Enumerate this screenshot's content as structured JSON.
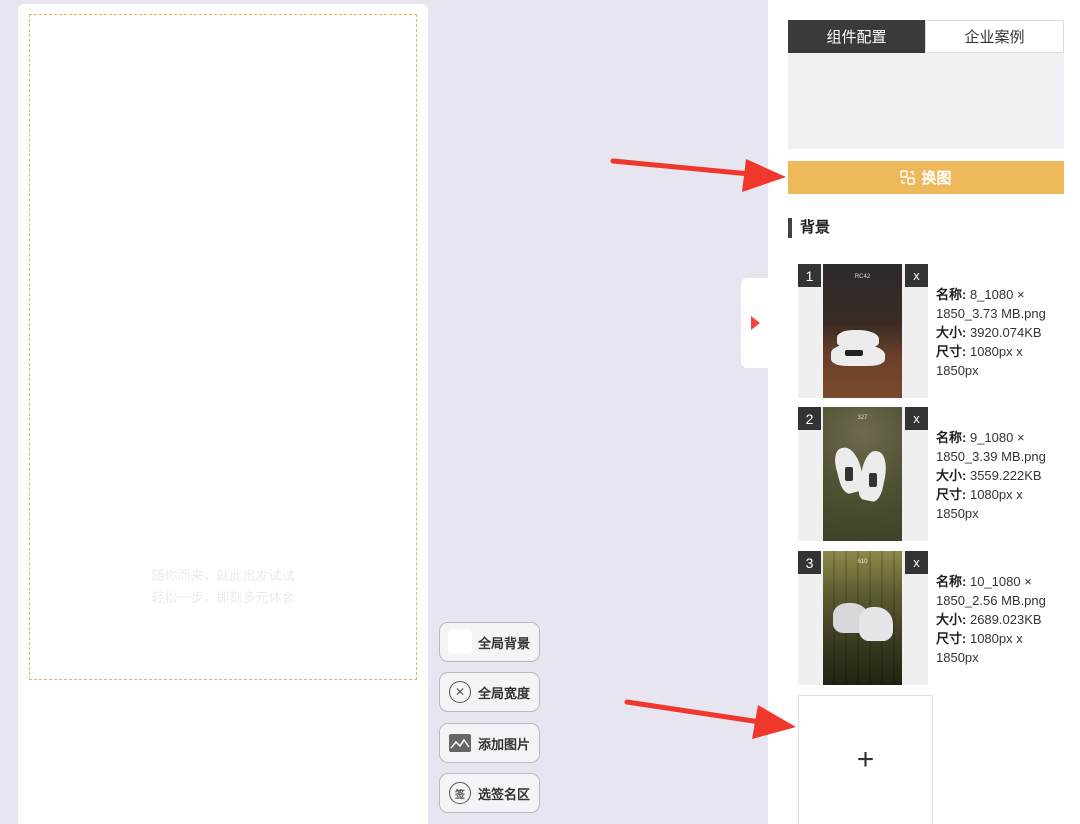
{
  "canvas": {
    "placeholder_line1": "随你而来，就此出发试试",
    "placeholder_line2": "轻松一步，即刻多元体会"
  },
  "tools": [
    {
      "label": "全局背景",
      "icon": "swatch-icon"
    },
    {
      "label": "全局宽度",
      "icon": "close-circle-icon"
    },
    {
      "label": "添加图片",
      "icon": "image-icon"
    },
    {
      "label": "选签名区",
      "icon": "sign-icon"
    }
  ],
  "tool_sign_glyph": "签",
  "panel": {
    "tabs": [
      "组件配置",
      "企业案例"
    ],
    "swap_label": "换图",
    "section_title": "背景",
    "items": [
      {
        "num": "1",
        "delete": "x",
        "badge": "RC42",
        "name_label": "名称:",
        "name": "8_1080 × 1850_3.73 MB.png",
        "size_label": "大小:",
        "size": "3920.074KB",
        "dim_label": "尺寸:",
        "dim": "1080px x 1850px"
      },
      {
        "num": "2",
        "delete": "x",
        "badge": "327",
        "name_label": "名称:",
        "name": "9_1080 × 1850_3.39 MB.png",
        "size_label": "大小:",
        "size": "3559.222KB",
        "dim_label": "尺寸:",
        "dim": "1080px x 1850px"
      },
      {
        "num": "3",
        "delete": "x",
        "badge": "610",
        "name_label": "名称:",
        "name": "10_1080 × 1850_2.56 MB.png",
        "size_label": "大小:",
        "size": "2689.023KB",
        "dim_label": "尺寸:",
        "dim": "1080px x 1850px"
      }
    ],
    "add_label": "+"
  },
  "colors": {
    "accent": "#edb95a",
    "arrow": "#f0372b",
    "tab_active": "#3a3a3d"
  }
}
